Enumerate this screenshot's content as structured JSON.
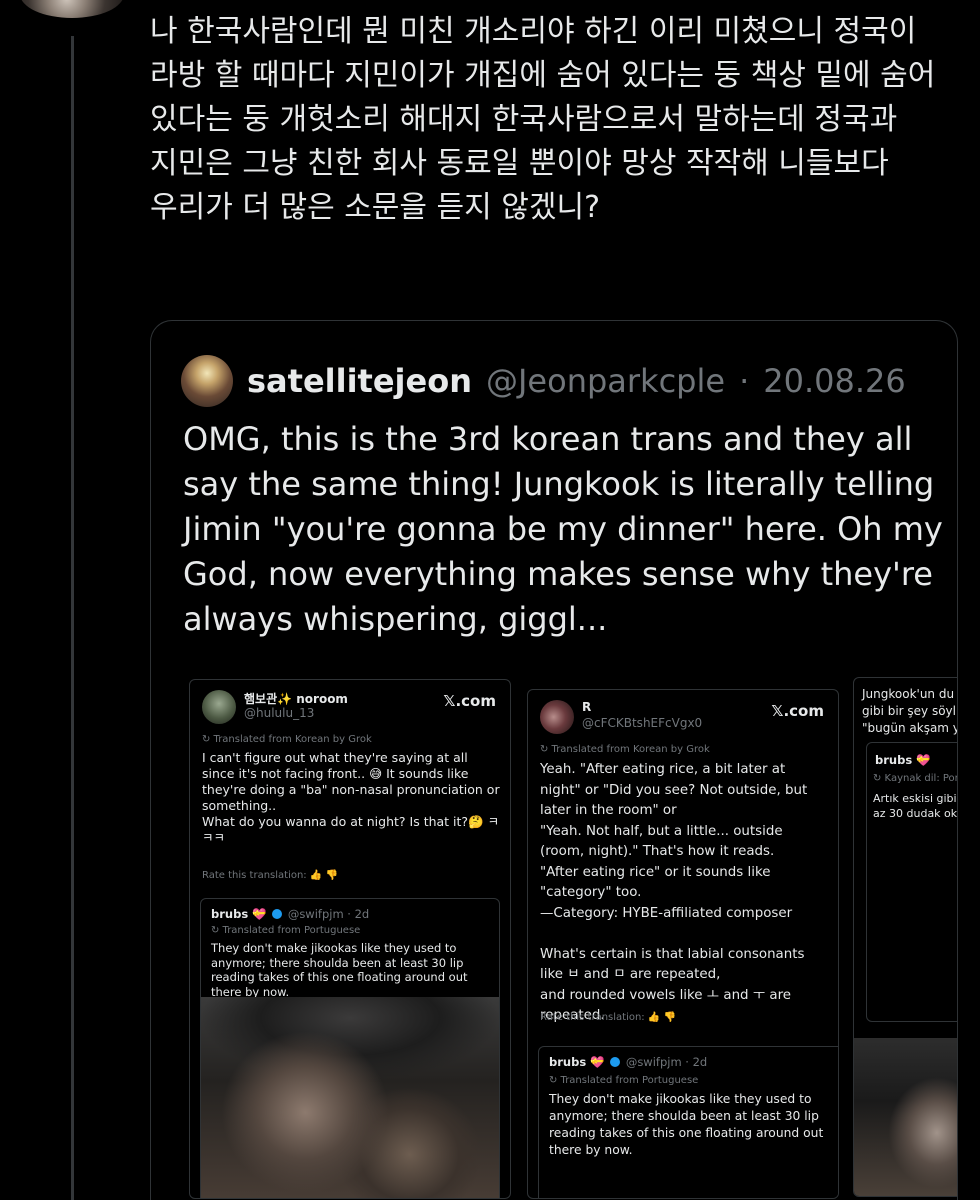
{
  "tweet": {
    "text": "나 한국사람인데 뭔 미친 개소리야 하긴 이리 미쳤으니 정국이 라방 할 때마다 지민이가 개집에 숨어 있다는 둥 책상 밑에 숨어 있다는 둥 개헛소리 해대지 한국사람으로서 말하는데 정국과 지민은 그냥 친한 회사 동료일 뿐이야 망상 작작해 니들보다 우리가 더 많은 소문을 듣지 않겠니?"
  },
  "quote": {
    "name": "satellitejeon",
    "handle": "@Jeonparkcple",
    "separator": "·",
    "date": "20.08.26",
    "text": "OMG, this is the 3rd korean trans and they all say the same thing! Jungkook is literally telling Jimin \"you're gonna be my dinner\" here. Oh my God, now everything makes sense why they're always whispering, giggl..."
  },
  "card1": {
    "name": "햄보관✨ noroom",
    "handle": "@hululu_13",
    "xcom": "𝕏.com",
    "translated": "↻ Translated from Korean by Grok",
    "body": "I can't figure out what they're saying at all since it's not facing front.. 😅 It sounds like they're doing a \"ba\" non-nasal pronunciation or something..\nWhat do you wanna do at night? Is that it?🤔 ㅋㅋㅋ",
    "rate": "Rate this translation: 👍 👎",
    "inner": {
      "name": "brubs 💝",
      "handle": "@swifpjm · 2d",
      "translated": "↻ Translated from Portuguese",
      "body": "They don't make jikookas like they used to anymore; there shoulda been at least 30 lip reading takes of this one floating around out there by now."
    }
  },
  "card2": {
    "name": "R",
    "handle": "@cFCKBtshEFcVgx0",
    "xcom": "𝕏.com",
    "translated": "↻ Translated from Korean by Grok",
    "body": "Yeah. \"After eating rice, a bit later at night\" or \"Did you see? Not outside, but later in the room\" or\n\"Yeah. Not half, but a little... outside (room, night).\" That's how it reads.\n\"After eating rice\" or it sounds like \"category\" too.\n—Category: HYBE-affiliated composer\n\nWhat's certain is that labial consonants like ㅂ and ㅁ are repeated,\nand rounded vowels like ㅗ and ㅜ are repeated.",
    "rate": "Rate this translation: 👍 👎",
    "inner": {
      "name": "brubs 💝",
      "handle": "@swifpjm · 2d",
      "translated": "↻ Translated from Portuguese",
      "body": "They don't make jikookas like they used to anymore; there shoulda been at least 30 lip reading takes of this one floating around out there by now."
    }
  },
  "card3": {
    "line1": "Jungkook'un du",
    "line2": "gibi bir şey söyl",
    "line3": "\"bugün akşam y",
    "inner_name": "brubs 💝",
    "inner_translated": "↻ Kaynak dil: Por",
    "inner_line1": "Artık eskisi gibi j",
    "inner_line2": "az 30 dudak oku"
  }
}
